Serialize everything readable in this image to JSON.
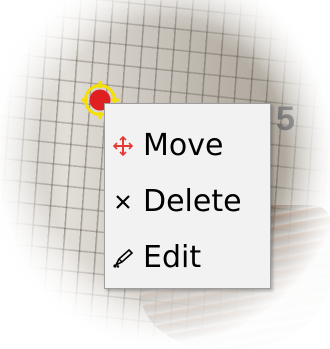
{
  "background": {
    "partial_label": "5"
  },
  "context_menu": {
    "items": [
      {
        "label": "Move",
        "icon": "move-cross-icon",
        "icon_color": "#e53935"
      },
      {
        "label": "Delete",
        "icon": "x-icon",
        "icon_color": "#000000"
      },
      {
        "label": "Edit",
        "icon": "pen-icon",
        "icon_color": "#000000"
      }
    ]
  },
  "marker": {
    "fill_color": "#e02020",
    "ring_color": "#f5e000"
  }
}
